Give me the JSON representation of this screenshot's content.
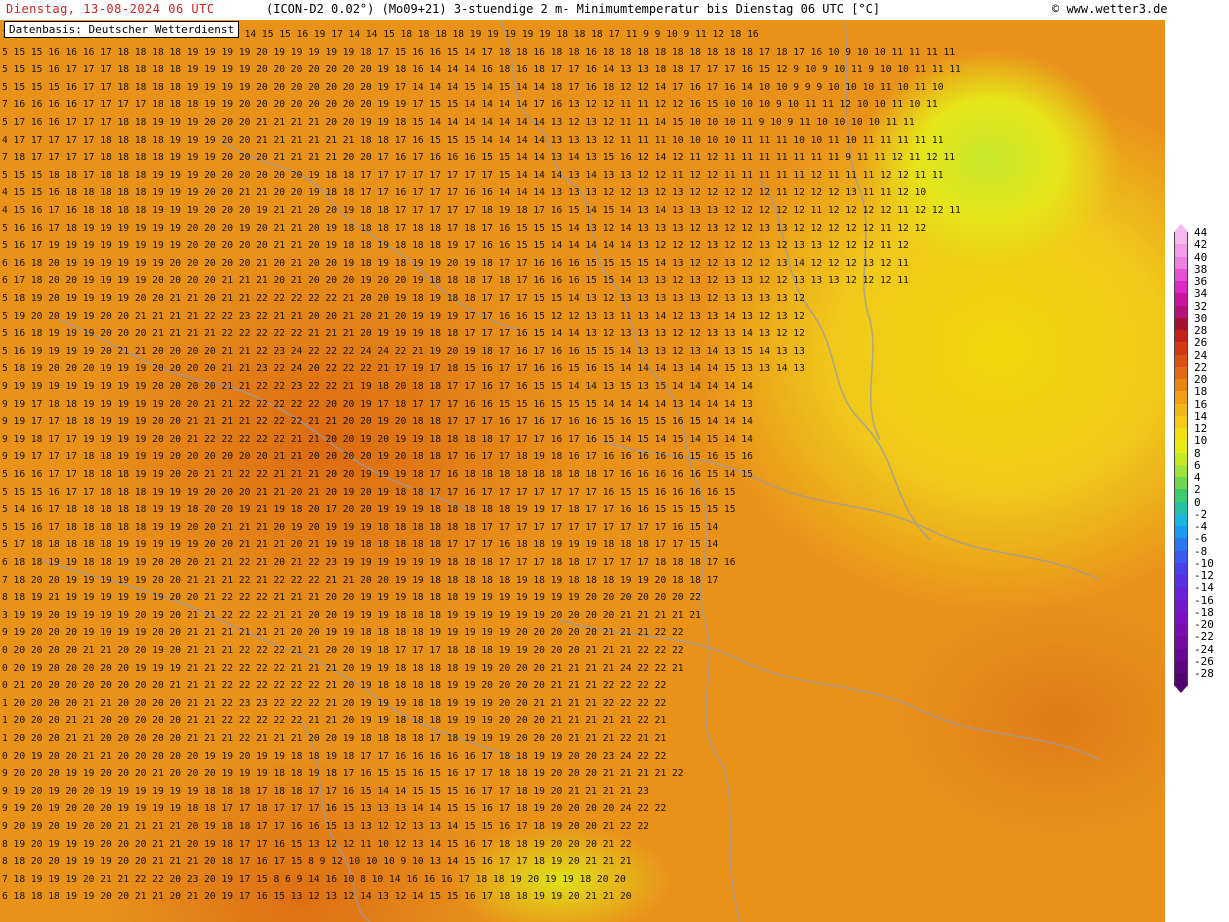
{
  "header": {
    "date_label": "Dienstag, 13-08-2024  06 UTC",
    "model_label": "(ICON-D2 0.02°) (Mo09+21) 3-stuendige 2 m- Minimumtemperatur bis Dienstag 06 UTC [°C]",
    "copyright": "© www.wetter3.de",
    "colors": {
      "date": "#d02020",
      "text": "#000000"
    }
  },
  "source_box": {
    "label": "Datenbasis: Deutscher Wetterdienst"
  },
  "map": {
    "unit": "°C",
    "background_color": "#e9921a",
    "rows": [
      "19 19 19 19 19 19 19 19 20 19 19 19 17 16 14 15 15 16 19 17 14 14 15 18 18 18 18 19 19 19 19 19 18 18 18 17 11 9 9 10 9 11 12 18 16",
      "5 15 15 16 16 16 17 18 18 18 18 19 19 19 19 20 19 19 19 19 19 18 17 15 16 16 15 14 17 18 18 16 18 18 16 18 18 18 18 18 18 18 18 18 17 18 17 16 10 9 10 10 11 11 11 11",
      "5 15 15 16 17 17 17 18 18 18 18 19 19 19 19 20 20 20 20 20 20 20 19 18 16 14 14 14 16 18 16 18 17 17 16 14 13 13 18 18 17 17 17 16 15 12 9 10 9 10 11 9 10 10 11 11 11",
      "5 15 15 15 16 17 17 18 18 18 18 19 19 19 19 20 20 20 20 20 20 20 19 17 14 14 14 15 14 15 14 14 18 17 16 18 12 12 14 17 16 17 16 14 10 10 9 9 9 10 10 10 11 10 11 10",
      "7 16 16 16 16 17 17 17 17 18 18 18 19 19 20 20 20 20 20 20 20 20 19 19 17 15 15 14 14 14 14 17 16 13 12 12 11 11 12 12 16 15 10 10 10 9 10 11 11 12 10 10 11 10 11",
      "5 17 16 16 17 17 17 18 18 19 19 19 20 20 20 21 21 21 21 20 20 19 19 18 15 14 14 14 14 14 14 14 13 12 13 12 11 11 14 15 10 10 10 11 9 10 9 11 10 10 10 10 11 11",
      "4 17 17 17 17 17 18 18 18 18 19 19 19 20 20 21 21 21 21 21 21 18 18 17 16 15 15 15 14 14 14 14 13 13 13 12 11 11 11 10 10 10 10 11 11 11 10 10 11 10 11 11 11 11 11",
      "7 18 17 17 17 17 18 18 18 18 19 19 19 20 20 20 21 21 21 21 20 20 17 16 17 16 16 16 15 15 14 14 13 14 13 15 16 12 14 12 11 12 11 11 11 11 11 11 11 9 11 11 12 11 12 11",
      "5 15 15 18 18 17 18 18 18 19 19 19 20 20 20 20 20 20 19 18 18 17 17 17 17 17 17 17 17 15 14 14 14 13 14 13 13 12 12 11 12 12 11 11 11 11 11 12 11 11 11 12 12 11 11",
      "4 15 15 16 18 18 18 18 18 19 19 19 20 20 21 21 20 20 19 18 18 17 17 16 17 17 17 16 16 14 14 14 13 13 13 12 12 13 12 13 12 12 12 12 12 11 12 12 12 13 11 11 12 10",
      "4 15 16 17 16 18 18 18 18 19 19 19 20 20 20 19 21 21 20 20 19 18 18 17 17 17 17 17 18 19 18 17 16 15 14 15 14 13 14 13 13 13 12 12 12 12 12 11 12 12 12 12 11 12 12 11",
      "5 16 16 17 18 19 19 19 19 19 19 20 20 20 19 20 21 21 20 19 18 18 18 17 18 18 17 18 17 16 15 15 15 14 13 12 14 13 13 13 12 13 12 12 13 13 12 12 12 12 12 11 12 12",
      "5 16 17 19 19 19 19 19 19 19 19 20 20 20 20 20 21 21 20 19 18 18 19 18 18 18 19 17 16 16 15 15 14 14 14 14 14 13 12 12 12 13 12 12 13 12 13 13 12 12 12 11 12",
      "6 16 18 20 19 19 19 19 19 19 20 20 20 20 20 21 20 21 20 20 19 18 19 18 19 19 20 19 18 17 17 16 16 16 15 15 15 15 14 13 12 12 13 12 12 13 14 12 12 12 13 12 11",
      "6 17 18 20 20 19 19 19 19 20 20 20 20 21 21 21 20 21 20 20 20 19 20 20 19 18 18 18 17 18 17 16 16 16 15 15 14 13 13 12 13 12 13 13 12 12 13 13 13 12 12 12 11",
      "5 18 19 20 19 19 19 19 20 20 21 21 20 21 21 22 22 22 22 22 21 20 20 19 18 19 18 18 17 17 17 15 15 14 13 12 13 13 13 13 13 12 13 13 13 13 12",
      "5 19 20 20 19 19 20 20 21 21 21 21 22 22 23 22 21 21 20 20 21 20 21 20 19 19 19 17 17 16 16 15 12 12 13 13 11 13 14 12 13 13 14 13 12 13 12",
      "5 16 18 19 19 19 20 20 20 21 21 21 21 22 22 22 22 22 21 21 21 20 19 19 19 18 18 17 17 17 16 15 14 14 13 12 13 13 13 12 12 13 13 14 13 12 12",
      "5 16 19 19 19 19 20 21 21 20 20 20 20 21 21 22 23 24 22 22 22 24 24 22 21 19 20 19 18 17 16 17 16 16 15 15 14 13 13 12 13 14 13 15 14 13 13",
      "5 18 19 20 20 20 19 19 19 20 20 20 20 21 21 23 22 24 20 22 22 22 21 17 19 17 18 15 16 17 17 16 16 15 16 15 14 14 14 13 14 14 15 13 13 14 13",
      "9 19 19 19 19 19 19 19 19 20 20 20 20 21 21 22 22 23 22 22 21 19 18 20 18 18 17 17 16 17 16 15 15 14 14 13 15 13 15 14 14 14 14 14",
      "9 19 17 18 18 19 19 19 19 19 20 20 21 21 22 22 22 22 22 20 20 19 17 18 17 17 17 16 16 15 15 16 15 15 15 14 14 14 14 13 14 14 14 13",
      "9 19 17 17 18 18 19 19 19 20 20 21 21 21 21 22 22 22 21 21 20 20 19 20 18 18 17 17 17 16 17 16 17 16 16 15 16 15 15 16 15 14 14 14",
      "9 19 18 17 17 19 19 19 19 20 20 21 22 22 22 22 22 21 21 20 20 19 20 19 19 18 18 18 18 17 17 17 16 17 16 15 14 15 14 15 14 15 14 14",
      "9 19 17 17 17 18 18 19 19 19 20 20 20 20 20 20 21 21 20 20 20 20 19 20 18 18 17 16 17 17 18 19 18 16 17 16 16 16 16 16 15 16 15 16",
      "5 16 16 17 17 18 18 18 19 19 20 20 21 21 22 22 21 21 21 20 20 19 19 19 18 17 16 18 18 18 18 18 18 18 18 17 16 16 16 16 16 15 14 15",
      "5 15 15 16 17 17 18 18 18 19 19 19 20 20 20 21 21 20 21 20 19 20 19 18 18 17 17 16 17 17 17 17 17 17 17 16 15 15 16 16 16 16 15",
      "5 14 16 17 18 18 18 18 18 19 19 18 20 20 19 21 19 18 20 17 20 20 19 19 19 18 18 18 18 18 19 19 17 18 17 17 16 16 15 15 15 15 15",
      "5 15 16 17 18 18 18 18 18 19 19 20 20 21 21 21 20 19 20 19 19 19 18 18 18 18 18 18 17 17 17 17 17 17 17 17 17 17 17 16 15 14",
      "5 17 18 18 18 18 18 19 19 19 19 19 20 20 21 21 21 20 21 19 19 18 18 18 18 18 17 17 17 16 18 18 19 19 19 18 18 18 17 17 15 14",
      "6 18 18 19 19 18 18 19 19 20 20 20 21 21 22 21 20 21 22 23 19 19 19 19 19 19 18 18 18 17 17 17 18 18 17 17 17 17 18 18 18 17 16",
      "7 18 20 20 19 19 19 19 19 20 20 21 21 21 22 21 22 22 22 21 21 20 20 19 19 18 18 18 18 18 19 18 19 18 18 18 19 19 20 18 18 17",
      "8 18 19 21 19 19 19 19 19 19 20 20 21 22 22 22 21 21 21 20 20 19 19 19 18 18 18 19 19 19 19 19 19 19 20 20 20 20 20 20 22",
      "3 19 19 20 19 19 19 19 20 19 20 21 21 22 22 22 21 21 20 20 19 19 19 18 18 18 19 19 19 19 19 19 20 20 20 20 21 21 21 21 21",
      "9 19 20 20 20 19 19 19 19 20 20 21 21 21 21 21 21 20 20 19 19 18 18 18 18 19 19 19 19 19 20 20 20 20 20 21 21 21 22 22",
      "0 20 20 20 20 21 21 20 20 19 20 21 21 21 22 22 22 21 21 20 20 19 18 17 17 17 18 18 18 19 19 20 20 20 21 21 21 22 22 22",
      "0 20 19 20 20 20 20 20 19 19 19 21 21 22 22 22 22 21 21 21 20 19 19 18 18 18 18 19 19 20 20 20 21 21 21 21 24 22 22 21",
      "0 21 20 20 20 20 20 20 20 20 21 21 21 22 22 22 22 22 22 21 20 19 18 18 18 18 19 19 20 20 20 20 21 21 21 22 22 22 22",
      "1 20 20 20 20 21 21 20 20 20 20 21 21 22 23 23 22 22 22 21 20 19 19 19 18 18 19 19 19 20 20 21 21 21 21 22 22 22 22",
      "1 20 20 20 21 21 20 20 20 20 20 21 21 22 22 22 22 22 21 21 20 19 19 18 18 18 19 19 19 20 20 20 21 21 21 21 21 22 21",
      "1 20 20 20 21 21 20 20 20 20 20 21 21 21 22 21 21 21 20 20 19 18 18 18 18 17 18 19 19 19 20 20 20 21 21 21 22 21 21",
      "0 20 19 20 20 21 21 20 20 20 20 20 19 19 20 19 19 18 18 19 18 17 17 16 16 16 16 16 17 18 18 19 19 20 20 23 24 22 22",
      "9 20 20 20 19 19 20 20 20 21 20 20 20 19 19 19 18 18 19 18 17 16 15 15 16 15 16 17 17 18 18 19 20 20 20 21 21 21 21 22",
      "9 19 20 19 20 20 19 19 19 19 19 19 18 18 18 17 18 18 17 17 16 15 14 14 15 15 15 16 17 17 18 19 20 21 21 21 21 23",
      "9 19 20 19 20 20 20 19 19 19 19 18 18 17 17 18 17 17 17 16 15 13 13 13 14 14 15 15 16 17 18 19 20 20 20 20 24 22 22",
      "9 20 19 20 19 20 20 21 21 21 21 20 19 18 18 17 17 16 16 15 13 13 12 12 13 13 14 15 15 16 17 18 19 20 20 21 22 22",
      "8 19 20 19 19 19 20 20 20 21 21 20 19 18 17 17 16 15 13 12 12 11 10 12 13 14 15 16 17 18 18 19 20 20 20 21 22",
      "8 18 20 20 19 19 19 20 20 21 21 21 20 18 17 16 17 15 8 9 12 10 10 10 9 10 13 14 15 16 17 17 18 19 20 21 21 21",
      "7 18 19 19 19 20 21 21 22 22 20 23 20 19 17 15 8 6 9 14 16 10 8 10 14 16 16 16 17 18 18 19 20 19 19 18 20 20",
      "6 18 18 18 19 19 20 20 21 21 20 21 20 19 17 16 15 13 12 13 12 14 13 12 14 15 15 16 17 18 18 19 19 20 21 21 20"
    ]
  },
  "legend": {
    "unit": "°C",
    "entries": [
      {
        "value": "44",
        "color": "#f7b8f0"
      },
      {
        "value": "42",
        "color": "#f39ce8"
      },
      {
        "value": "40",
        "color": "#ee7ee0"
      },
      {
        "value": "38",
        "color": "#e64fd2"
      },
      {
        "value": "36",
        "color": "#dd28c5"
      },
      {
        "value": "34",
        "color": "#c9149f"
      },
      {
        "value": "32",
        "color": "#b51278"
      },
      {
        "value": "30",
        "color": "#a81030"
      },
      {
        "value": "28",
        "color": "#c22218"
      },
      {
        "value": "26",
        "color": "#d23a16"
      },
      {
        "value": "24",
        "color": "#db5214"
      },
      {
        "value": "22",
        "color": "#e26a12"
      },
      {
        "value": "20",
        "color": "#e98514"
      },
      {
        "value": "18",
        "color": "#ef9e16"
      },
      {
        "value": "16",
        "color": "#f3b618"
      },
      {
        "value": "14",
        "color": "#f5ca14"
      },
      {
        "value": "12",
        "color": "#f3de10"
      },
      {
        "value": "10",
        "color": "#e8ec12"
      },
      {
        "value": "8",
        "color": "#c6ea22"
      },
      {
        "value": "6",
        "color": "#9ee23a"
      },
      {
        "value": "4",
        "color": "#6cd850"
      },
      {
        "value": "2",
        "color": "#3ecc70"
      },
      {
        "value": "0",
        "color": "#26c2a8"
      },
      {
        "value": "-2",
        "color": "#1ab8de"
      },
      {
        "value": "-4",
        "color": "#1a9af0"
      },
      {
        "value": "-6",
        "color": "#2a78f2"
      },
      {
        "value": "-8",
        "color": "#3a5af0"
      },
      {
        "value": "-10",
        "color": "#4a40ec"
      },
      {
        "value": "-12",
        "color": "#5a30e4"
      },
      {
        "value": "-14",
        "color": "#6a22d8"
      },
      {
        "value": "-16",
        "color": "#7418cc"
      },
      {
        "value": "-18",
        "color": "#7c10c0"
      },
      {
        "value": "-20",
        "color": "#7a0cb2"
      },
      {
        "value": "-22",
        "color": "#730aa2"
      },
      {
        "value": "-24",
        "color": "#680892"
      },
      {
        "value": "-26",
        "color": "#5c0682"
      },
      {
        "value": "-28",
        "color": "#500472"
      }
    ]
  }
}
